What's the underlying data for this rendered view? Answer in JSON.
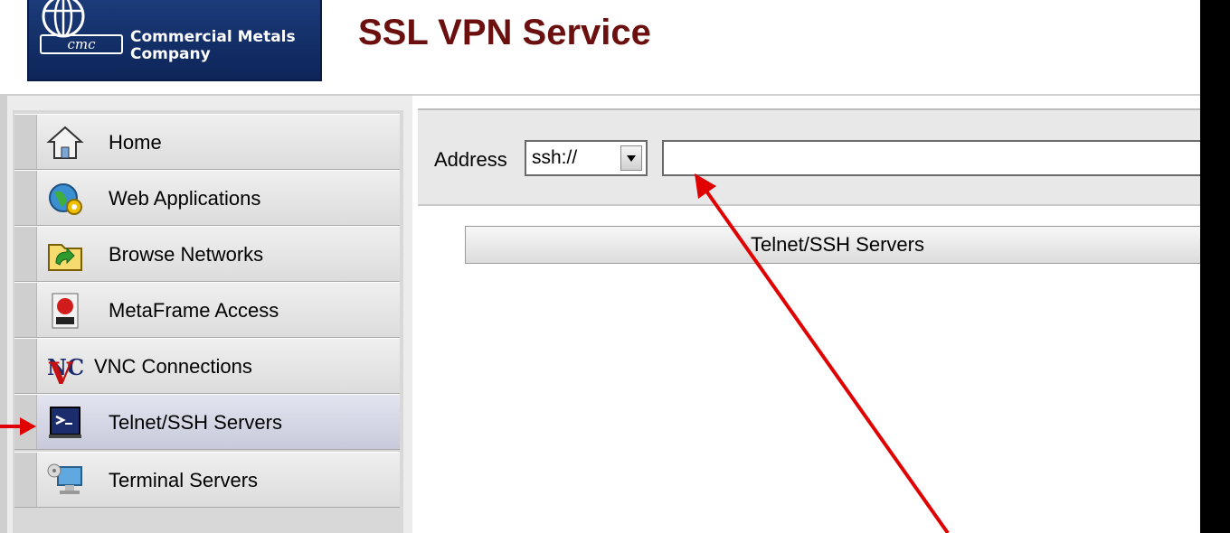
{
  "header": {
    "logo_line1": "Commercial Metals",
    "logo_line2": "Company",
    "logo_mark": "cmc",
    "title": "SSL VPN Service"
  },
  "sidebar": {
    "items": [
      {
        "label": "Home",
        "icon": "home-icon"
      },
      {
        "label": "Web Applications",
        "icon": "web-applications-icon"
      },
      {
        "label": "Browse Networks",
        "icon": "browse-networks-icon"
      },
      {
        "label": "MetaFrame Access",
        "icon": "metaframe-icon"
      },
      {
        "label": "VNC Connections",
        "icon": "vnc-icon"
      },
      {
        "label": "Telnet/SSH Servers",
        "icon": "terminal-icon",
        "active": true
      },
      {
        "label": "Terminal Servers",
        "icon": "terminal-servers-icon"
      }
    ]
  },
  "address_bar": {
    "label": "Address",
    "protocol": "ssh://",
    "value": ""
  },
  "servers": {
    "header": "Telnet/SSH Servers"
  },
  "colors": {
    "title": "#6b0f0f",
    "logo_bg": "#1b3b7a",
    "annotation_arrow": "#e00000",
    "active_item": "#c8cadb"
  }
}
